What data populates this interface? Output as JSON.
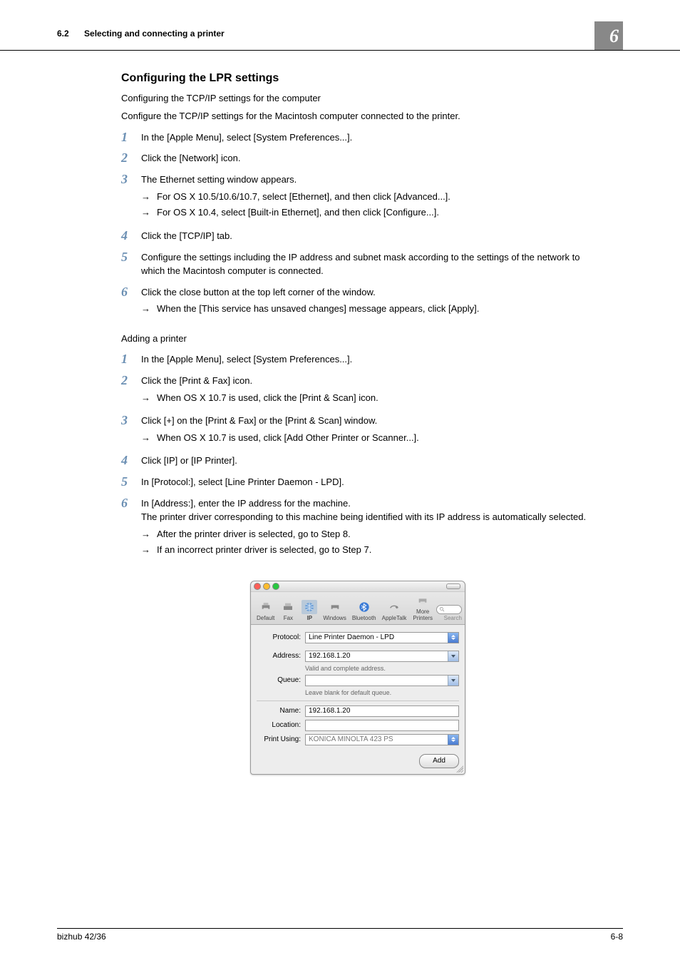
{
  "header": {
    "section_number": "6.2",
    "section_title": "Selecting and connecting a printer",
    "chapter_number": "6"
  },
  "h3_1": "Configuring the LPR settings",
  "intro_1": "Configuring the TCP/IP settings for the computer",
  "intro_2": "Configure the TCP/IP settings for the Macintosh computer connected to the printer.",
  "stepsA": {
    "1": {
      "text": "In the [Apple Menu], select [System Preferences...]."
    },
    "2": {
      "text": "Click the [Network] icon."
    },
    "3": {
      "text": "The Ethernet setting window appears.",
      "sub": [
        "For OS X 10.5/10.6/10.7, select [Ethernet], and then click [Advanced...].",
        "For OS X 10.4, select [Built-in Ethernet], and then click [Configure...]."
      ]
    },
    "4": {
      "text": "Click the [TCP/IP] tab."
    },
    "5": {
      "text": "Configure the settings including the IP address and subnet mask according to the settings of the network to which the Macintosh computer is connected."
    },
    "6": {
      "text": "Click the close button at the top left corner of the window.",
      "sub": [
        "When the [This service has unsaved changes] message appears, click [Apply]."
      ]
    }
  },
  "sub_heading": "Adding a printer",
  "stepsB": {
    "1": {
      "text": "In the [Apple Menu], select [System Preferences...]."
    },
    "2": {
      "text": "Click the [Print & Fax] icon.",
      "sub": [
        "When OS X 10.7 is used, click the [Print & Scan] icon."
      ]
    },
    "3": {
      "text": "Click [+] on the [Print & Fax] or the [Print & Scan] window.",
      "sub": [
        "When OS X 10.7 is used, click [Add Other Printer or Scanner...]."
      ]
    },
    "4": {
      "text": "Click [IP] or [IP Printer]."
    },
    "5": {
      "text": "In [Protocol:], select [Line Printer Daemon - LPD]."
    },
    "6": {
      "text": "In [Address:], enter the IP address for the machine.",
      "text2": "The printer driver corresponding to this machine being identified with its IP address is automatically selected.",
      "sub": [
        "After the printer driver is selected, go to Step 8.",
        "If an incorrect printer driver is selected, go to Step 7."
      ]
    }
  },
  "dialog": {
    "toolbar": {
      "items": [
        "Default",
        "Fax",
        "IP",
        "Windows",
        "Bluetooth",
        "AppleTalk",
        "More Printers"
      ],
      "selected_index": 2,
      "search_label": "Search"
    },
    "labels": {
      "protocol": "Protocol:",
      "address": "Address:",
      "queue": "Queue:",
      "name": "Name:",
      "location": "Location:",
      "print_using": "Print Using:"
    },
    "values": {
      "protocol": "Line Printer Daemon - LPD",
      "address": "192.168.1.20",
      "address_hint": "Valid and complete address.",
      "queue": "",
      "queue_hint": "Leave blank for default queue.",
      "name": "192.168.1.20",
      "location": "",
      "print_using": "KONICA MINOLTA 423 PS"
    },
    "add_button": "Add"
  },
  "footer": {
    "product": "bizhub 42/36",
    "page": "6-8"
  }
}
